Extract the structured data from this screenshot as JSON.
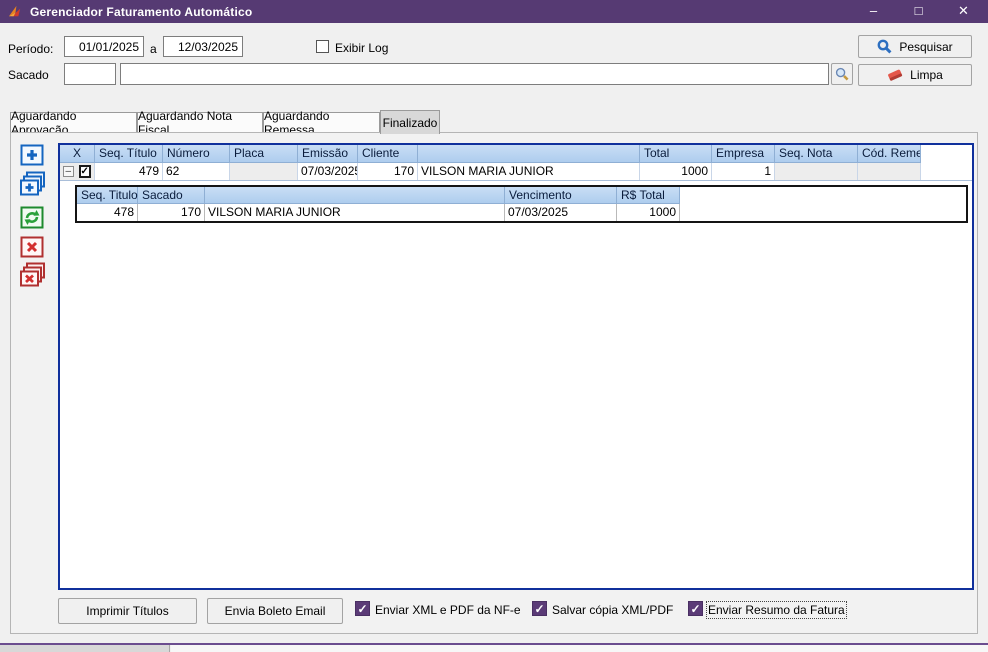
{
  "window": {
    "title": "Gerenciador Faturamento Automático",
    "minimize": "–",
    "maximize": "□",
    "close": "✕"
  },
  "filters": {
    "period_label": "Período:",
    "period_from": "01/01/2025",
    "between_label": "a",
    "period_to": "12/03/2025",
    "exibir_log": {
      "label": "Exibir Log",
      "checked": false
    },
    "sacado_label": "Sacado",
    "sacado_code": "",
    "sacado_name": "",
    "pesquisar_button": "Pesquisar",
    "limpa_button": "Limpa"
  },
  "tabs": {
    "items": [
      {
        "label": "Aguardando Aprovação",
        "active": false
      },
      {
        "label": "Aguardando Nota Fiscal",
        "active": false
      },
      {
        "label": "Aguardando Remessa",
        "active": false
      },
      {
        "label": "Finalizado",
        "active": true
      }
    ]
  },
  "toolbar": {
    "icons": [
      "add-record-icon",
      "add-multiple-records-icon",
      "refresh-icon",
      "delete-record-icon",
      "delete-multiple-records-icon"
    ]
  },
  "grid": {
    "headers": [
      "X",
      "Seq. Título",
      "Número",
      "Placa",
      "Emissão",
      "Cliente",
      "",
      "Total",
      "Empresa",
      "Seq. Nota",
      "Cód. Remessa"
    ],
    "row": {
      "expanded": true,
      "expander_glyph": "–",
      "checked": true,
      "seq_titulo": "479",
      "numero": "62",
      "placa": "",
      "emissao": "07/03/2025",
      "cliente": "170",
      "cliente_nome": "VILSON MARIA JUNIOR",
      "total": "1000",
      "empresa": "1",
      "seq_nota": "",
      "cod_remessa": ""
    },
    "detail": {
      "headers": [
        "Seq. Titulo",
        "Sacado",
        "",
        "Vencimento",
        "R$ Total"
      ],
      "row": {
        "seq_titulo": "478",
        "sacado": "170",
        "sacado_nome": "VILSON MARIA JUNIOR",
        "vencimento": "07/03/2025",
        "rs_total": "1000"
      }
    }
  },
  "footer": {
    "imprimir_button": "Imprimir Títulos",
    "boleto_button": "Envia Boleto Email",
    "checkboxes": [
      {
        "label": "Enviar XML e PDF da NF-e",
        "checked": true
      },
      {
        "label": "Salvar cópia XML/PDF",
        "checked": true
      },
      {
        "label": "Enviar Resumo da Fatura",
        "checked": true,
        "focused": true
      }
    ]
  },
  "colors": {
    "titlebar": "#563a73",
    "grid_header": "#aecdee",
    "grid_border": "#10309c",
    "checkbox_accent": "#5b3b77",
    "statusbar_line": "#6b4d8f"
  }
}
